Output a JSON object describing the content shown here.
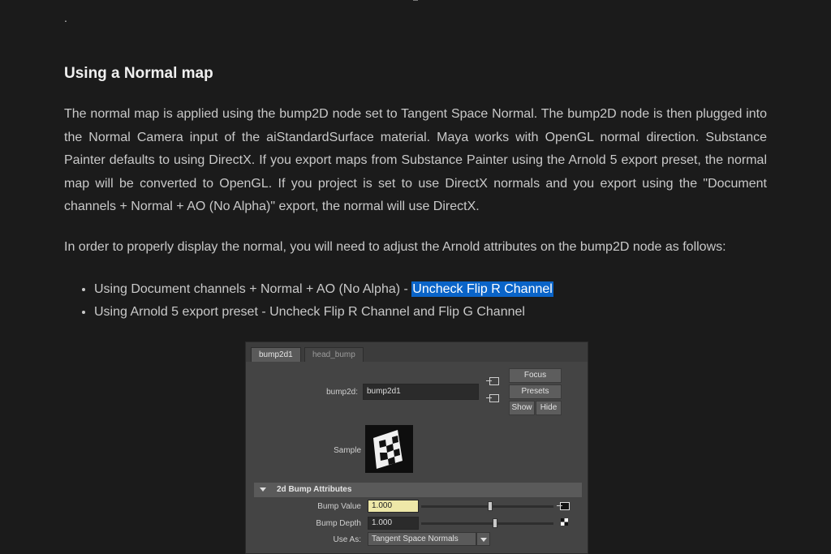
{
  "page": {
    "leading_mark": ".",
    "heading": "Using a Normal map",
    "paragraph1": "The normal map is applied using the bump2D node set to Tangent Space Normal. The bump2D node is then plugged into the Normal Camera input of the aiStandardSurface material. Maya works with OpenGL normal direction. Substance Painter defaults to using DirectX. If you export maps from Substance Painter using the Arnold 5 export preset, the normal map will be converted to OpenGL. If you project is set to use DirectX normals and you export using the \"Document channels + Normal + AO (No Alpha)\" export, the normal will use DirectX.",
    "paragraph2": "In order to properly display the normal, you will need to adjust the Arnold attributes on the bump2D node as follows:",
    "bullets": [
      {
        "prefix": "Using Document channels + Normal + AO (No Alpha) - ",
        "highlight": "Uncheck Flip R Channel"
      },
      {
        "text": "Using Arnold 5 export preset - Uncheck Flip R Channel and Flip G Channel"
      }
    ],
    "highlight_color": "#0a64c8"
  },
  "maya": {
    "tabs": [
      "bump2d1",
      "head_bump"
    ],
    "node_label": "bump2d:",
    "node_value": "bump2d1",
    "buttons": {
      "focus": "Focus",
      "presets": "Presets",
      "show": "Show",
      "hide": "Hide"
    },
    "sample_label": "Sample",
    "section_title": "2d Bump Attributes",
    "bump_value_label": "Bump Value",
    "bump_value": "1.000",
    "bump_value_slider": 0.52,
    "bump_depth_label": "Bump Depth",
    "bump_depth": "1.000",
    "bump_depth_slider": 0.56,
    "use_as_label": "Use As:",
    "use_as_value": "Tangent Space Normals"
  }
}
